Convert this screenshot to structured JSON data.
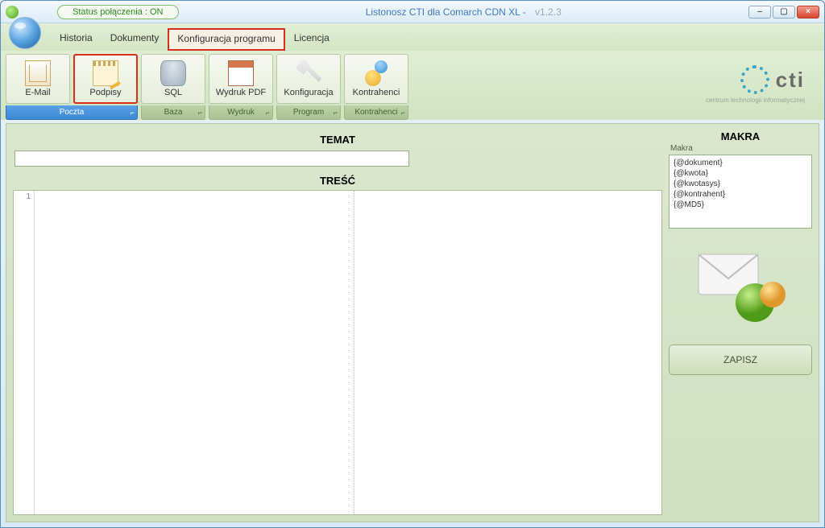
{
  "titlebar": {
    "status": "Status połączenia : ON",
    "title": "Listonosz CTI dla Comarch CDN XL -",
    "version": "v1.2.3",
    "min": "–",
    "max": "▢",
    "close": "×"
  },
  "menu": {
    "items": [
      "Historia",
      "Dokumenty",
      "Konfiguracja programu",
      "Licencja"
    ],
    "active_index": 2
  },
  "ribbon": {
    "groups": [
      {
        "label": "Poczta",
        "blue": true,
        "buttons": [
          {
            "name": "email",
            "label": "E-Mail",
            "icon": "ico-email"
          },
          {
            "name": "podpisy",
            "label": "Podpisy",
            "icon": "ico-note",
            "highlight": true
          }
        ]
      },
      {
        "label": "Baza",
        "buttons": [
          {
            "name": "sql",
            "label": "SQL",
            "icon": "ico-db"
          }
        ]
      },
      {
        "label": "Wydruk",
        "buttons": [
          {
            "name": "wydrukpdf",
            "label": "Wydruk PDF",
            "icon": "ico-cal"
          }
        ]
      },
      {
        "label": "Program",
        "buttons": [
          {
            "name": "konfiguracja",
            "label": "Konfiguracja",
            "icon": "ico-wrench"
          }
        ]
      },
      {
        "label": "Kontrahenci",
        "buttons": [
          {
            "name": "kontrahenci",
            "label": "Kontrahenci",
            "icon": "ico-users"
          }
        ]
      }
    ],
    "dialog_glyph": "⌐"
  },
  "logo": {
    "text": "cti",
    "sub": "centrum technologii\ninformatycznej"
  },
  "content": {
    "temat_label": "TEMAT",
    "temat_value": "",
    "tresc_label": "TREŚĆ",
    "gutter_first_line": "1",
    "makra_title": "MAKRA",
    "makra_sub": "Makra",
    "macros": [
      "{@dokument}",
      "{@kwota}",
      "{@kwotasys}",
      "{@kontrahent}",
      "{@MD5}"
    ],
    "save": "ZAPISZ"
  }
}
